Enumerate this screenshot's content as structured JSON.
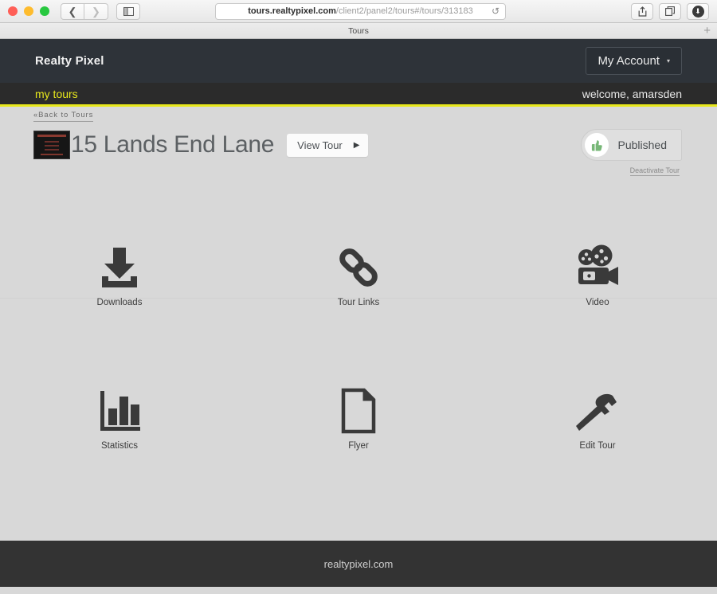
{
  "browser": {
    "url_host": "tours.realtypixel.com",
    "url_path": "/client2/panel2/tours#/tours/313183",
    "reload_icon": "reload-icon",
    "back_icon": "chevron-left-icon",
    "forward_icon": "chevron-right-icon",
    "sidebar_icon": "sidebar-toggle-icon",
    "share_icon": "share-icon",
    "tabs_icon": "show-tabs-icon",
    "download_icon": "downloads-icon",
    "tab_title": "Tours",
    "new_tab_label": "+"
  },
  "header": {
    "brand": "Realty Pixel",
    "account_label": "My Account",
    "account_caret": "▾",
    "nav_link": "my tours",
    "welcome": "welcome, amarsden",
    "accent_color": "#e8e81c",
    "bar_color": "#2e3339"
  },
  "page": {
    "back_link": "«Back to Tours",
    "title": "15 Lands End Lane",
    "view_tour_label": "View Tour",
    "view_tour_arrow": "▶",
    "status_label": "Published",
    "status_icon": "thumbs-up-icon",
    "status_color": "#77b777",
    "deactivate_label": "Deactivate Tour"
  },
  "tiles": [
    {
      "label": "Downloads",
      "icon": "download-arrow-icon"
    },
    {
      "label": "Tour Links",
      "icon": "chain-link-icon"
    },
    {
      "label": "Video",
      "icon": "movie-camera-icon"
    },
    {
      "label": "Statistics",
      "icon": "bar-chart-icon"
    },
    {
      "label": "Flyer",
      "icon": "document-page-icon"
    },
    {
      "label": "Edit Tour",
      "icon": "hammer-icon"
    }
  ],
  "footer": {
    "text": "realtypixel.com"
  }
}
